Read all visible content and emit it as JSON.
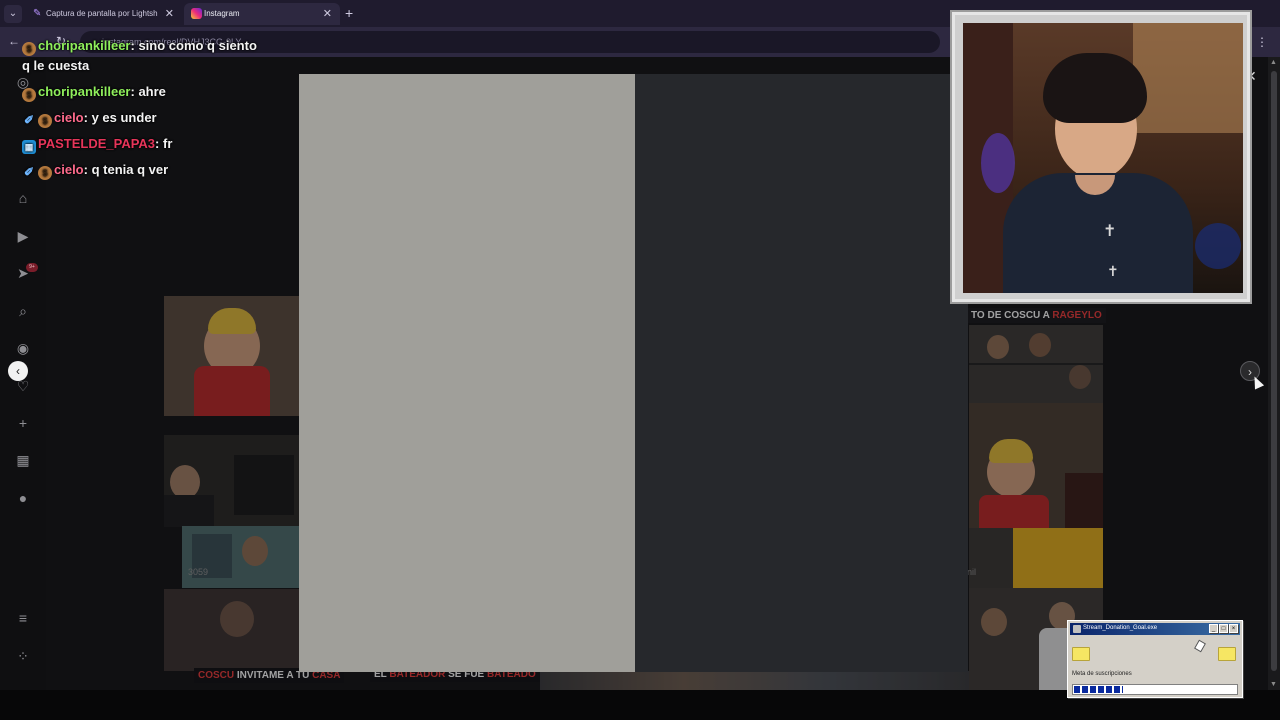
{
  "browser": {
    "tabs": [
      {
        "title": "Captura de pantalla por Lightshot",
        "active": false
      },
      {
        "title": "Instagram",
        "active": true
      }
    ],
    "url": "instagram.com/reel/DVHJ3CG-9LY"
  },
  "chat": [
    {
      "badges": [
        "money"
      ],
      "user": "choripankilleer",
      "color": "#8fef5c",
      "message": "sino como q siento"
    },
    {
      "badges": [],
      "user": "",
      "color": "#f4f4f4",
      "message": "q le cuesta"
    },
    {
      "badges": [
        "money"
      ],
      "user": "choripankilleer",
      "color": "#8fef5c",
      "message": "ahre"
    },
    {
      "badges": [
        "sword",
        "money"
      ],
      "user": "cielo",
      "color": "#ff6b8d",
      "message": "y es under"
    },
    {
      "badges": [
        "grid"
      ],
      "user": "PASTELDE_PAPA3",
      "color": "#e7355a",
      "message": "fr"
    },
    {
      "badges": [
        "sword",
        "money"
      ],
      "user": "cielo",
      "color": "#ff6b8d",
      "message": "q tenia q ver"
    }
  ],
  "reels": {
    "banner_left": {
      "pre": "COSCU",
      "rest": " INVITAME A TU ",
      "post": "CASA"
    },
    "banner_mid": {
      "pre": "EL ",
      "hl1": "BATEADOR",
      "mid": " SE FUE ",
      "hl2": "BATEADO"
    },
    "banner_right": {
      "pre": "TO DE COSCU A ",
      "hl": "RAGEYLO"
    },
    "views_left": "3059",
    "label_right": "nil"
  },
  "sidebar": {
    "notifications_badge": "9+"
  },
  "donation": {
    "title": "Stream_Donation_Goal.exe",
    "label": "Meta de suscripciones",
    "progress": 0.3
  },
  "colors": {
    "accent_green": "#8fef5c",
    "accent_pink": "#ff6b8d",
    "accent_red": "#e7355a",
    "banner_red": "#e23a3a"
  }
}
